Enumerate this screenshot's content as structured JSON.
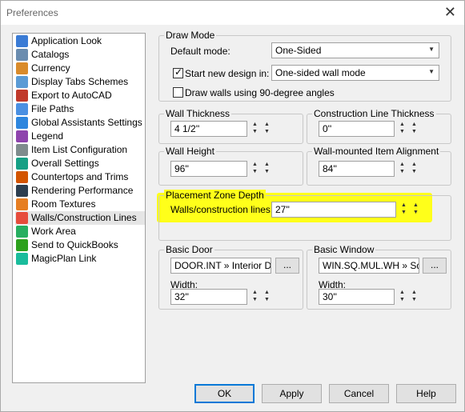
{
  "window": {
    "title": "Preferences"
  },
  "tree": {
    "items": [
      {
        "label": "Application Look",
        "icon": "application-look-icon"
      },
      {
        "label": "Catalogs",
        "icon": "catalogs-icon"
      },
      {
        "label": "Currency",
        "icon": "currency-icon"
      },
      {
        "label": "Display Tabs Schemes",
        "icon": "display-tabs-icon"
      },
      {
        "label": "Export to AutoCAD",
        "icon": "export-autocad-icon"
      },
      {
        "label": "File Paths",
        "icon": "file-paths-icon"
      },
      {
        "label": "Global Assistants Settings",
        "icon": "global-assistants-icon"
      },
      {
        "label": "Legend",
        "icon": "legend-icon"
      },
      {
        "label": "Item List Configuration",
        "icon": "item-list-icon"
      },
      {
        "label": "Overall Settings",
        "icon": "overall-settings-icon"
      },
      {
        "label": "Countertops and Trims",
        "icon": "countertops-icon"
      },
      {
        "label": "Rendering Performance",
        "icon": "rendering-icon"
      },
      {
        "label": "Room Textures",
        "icon": "room-textures-icon"
      },
      {
        "label": "Walls/Construction Lines",
        "icon": "walls-icon",
        "selected": true
      },
      {
        "label": "Work Area",
        "icon": "work-area-icon"
      },
      {
        "label": "Send to QuickBooks",
        "icon": "quickbooks-icon"
      },
      {
        "label": "MagicPlan Link",
        "icon": "magicplan-icon"
      }
    ]
  },
  "draw_mode": {
    "title": "Draw Mode",
    "default_mode_label": "Default mode:",
    "default_mode_value": "One-Sided",
    "start_new_label": "Start new design in:",
    "start_new_value": "One-sided wall mode",
    "draw_walls_label": "Draw walls using 90-degree angles"
  },
  "wall_thickness": {
    "title": "Wall Thickness",
    "value": "4 1/2''"
  },
  "construction_line_thickness": {
    "title": "Construction Line Thickness",
    "value": "0''"
  },
  "wall_height": {
    "title": "Wall Height",
    "value": "96''"
  },
  "wall_mounted": {
    "title": "Wall-mounted Item Alignment",
    "value": "84''"
  },
  "placement_zone": {
    "title": "Placement Zone Depth",
    "label": "Walls/construction lines:",
    "value": "27''"
  },
  "basic_door": {
    "title": "Basic Door",
    "item": "DOOR.INT » Interior Doo",
    "browse": "...",
    "width_label": "Width:",
    "width_value": "32''"
  },
  "basic_window": {
    "title": "Basic Window",
    "item": "WIN.SQ.MUL.WH » Squ",
    "browse": "...",
    "width_label": "Width:",
    "width_value": "30''"
  },
  "buttons": {
    "ok": "OK",
    "apply": "Apply",
    "cancel": "Cancel",
    "help": "Help"
  },
  "colors": {
    "highlight": "#ffff1a",
    "accent": "#0078d7"
  }
}
